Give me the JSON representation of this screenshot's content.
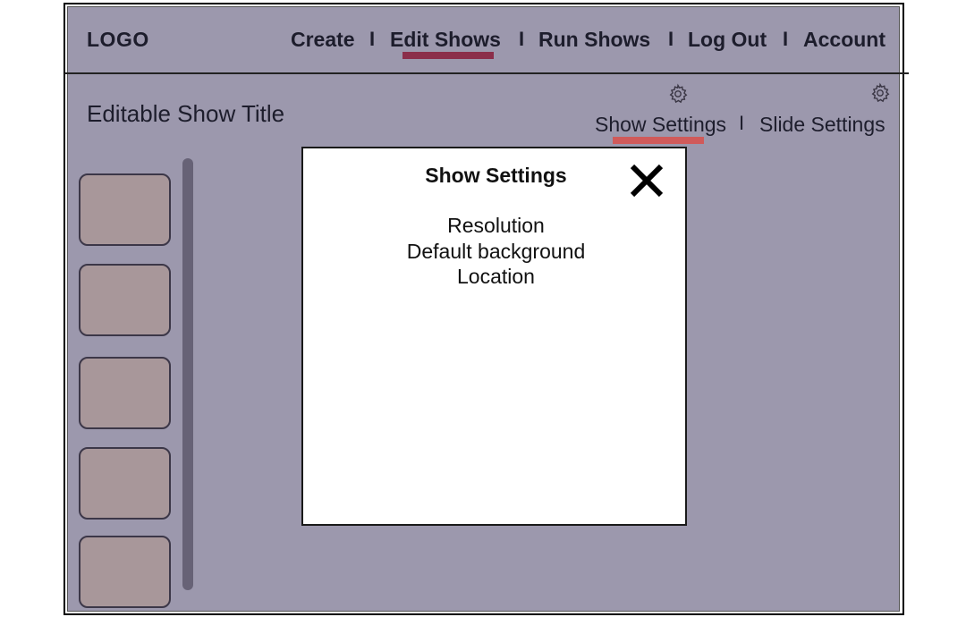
{
  "header": {
    "logo": "LOGO",
    "nav": [
      {
        "label": "Create"
      },
      {
        "label": "Edit Shows",
        "active": true
      },
      {
        "label": "Run Shows"
      },
      {
        "label": "Log Out"
      },
      {
        "label": "Account"
      }
    ],
    "separator": "I"
  },
  "editor": {
    "show_title": "Editable Show Title",
    "settings_links": [
      {
        "label": "Show Settings",
        "icon": "gear-icon",
        "active": true
      },
      {
        "label": "Slide Settings",
        "icon": "gear-icon"
      }
    ],
    "settings_separator": "I",
    "slide_thumbnails": 5
  },
  "modal": {
    "title": "Show Settings",
    "close_icon": "close-icon",
    "options": [
      "Resolution",
      "Default background",
      "Location"
    ]
  },
  "colors": {
    "background": "#9c98ad",
    "nav_active_underline": "#8b2e4a",
    "settings_active_underline": "#d05a5a",
    "thumbnail": "#a8979a",
    "scrollbar": "#676276",
    "modal_background": "#ffffff"
  }
}
